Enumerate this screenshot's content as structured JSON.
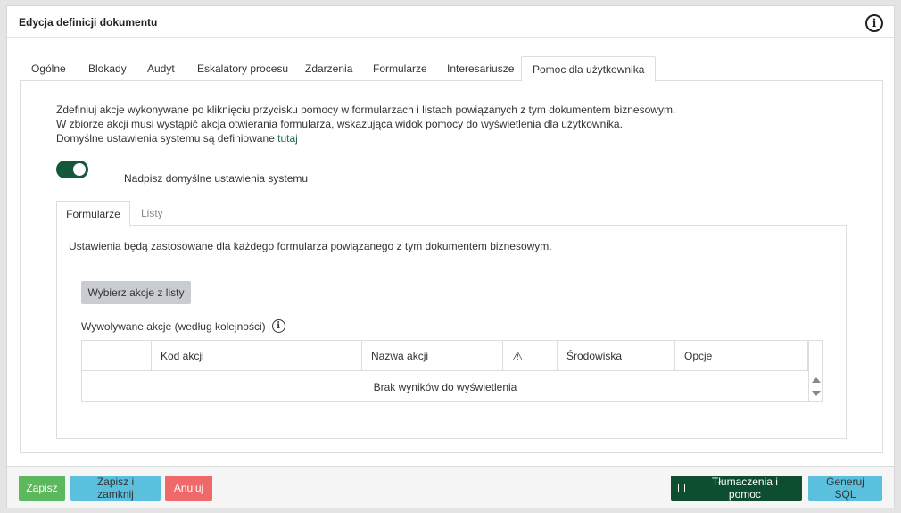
{
  "window": {
    "title": "Edycja definicji dokumentu",
    "info_icon": "info-icon"
  },
  "tabs": [
    {
      "label": "Ogólne"
    },
    {
      "label": "Blokady"
    },
    {
      "label": "Audyt"
    },
    {
      "label": "Eskalatory procesu"
    },
    {
      "label": "Zdarzenia"
    },
    {
      "label": "Formularze"
    },
    {
      "label": "Interesariusze"
    },
    {
      "label": "Pomoc dla użytkownika",
      "active": true
    }
  ],
  "help": {
    "line1": "Zdefiniuj akcje wykonywane po kliknięciu przycisku pomocy w formularzach i listach powiązanych z tym dokumentem biznesowym.",
    "line2": "W zbiorze akcji musi wystąpić akcja otwierania formularza, wskazująca widok pomocy do wyświetlenia dla użytkownika.",
    "line3_prefix": "Domyślne ustawienia systemu są definiowane",
    "line3_link": "tutaj",
    "toggle_on": true,
    "toggle_label": "Nadpisz domyślne ustawienia systemu"
  },
  "subtabs": [
    {
      "label": "Formularze",
      "active": true
    },
    {
      "label": "Listy"
    }
  ],
  "forms": {
    "description": "Ustawienia będą zastosowane dla każdego formularza powiązanego z tym dokumentem biznesowym.",
    "choose_button": "Wybierz akcje z listy",
    "list_label": "Wywoływane akcje (według kolejności)",
    "grid": {
      "columns": [
        "",
        "Kod akcji",
        "Nazwa akcji",
        "⚠",
        "Środowiska",
        "Opcje"
      ],
      "empty_text": "Brak wyników do wyświetlenia"
    }
  },
  "footer": {
    "save": "Zapisz",
    "save_close": "Zapisz i zamknij",
    "cancel": "Anuluj",
    "translate": "Tłumaczenia i pomoc",
    "generate_sql": "Generuj SQL"
  },
  "colors": {
    "primary_dark": "#0d4d30",
    "success": "#5cb85c",
    "info": "#5bc0de",
    "danger": "#f0696a"
  }
}
